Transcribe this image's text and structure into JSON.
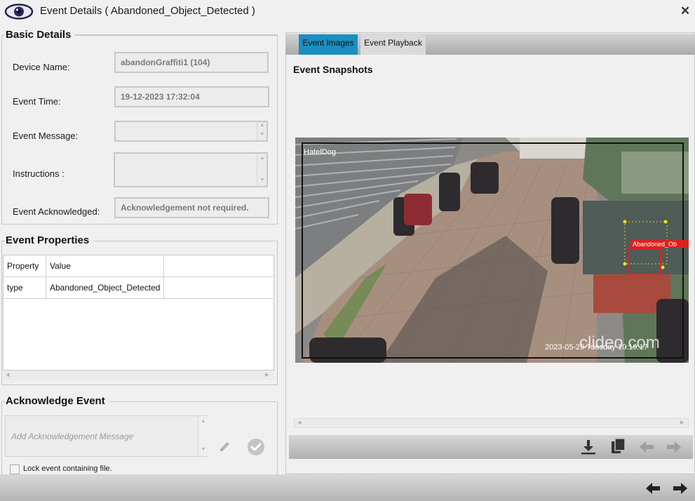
{
  "window": {
    "title": "Event Details ( Abandoned_Object_Detected )",
    "close_icon": "close-icon"
  },
  "basic_details": {
    "heading": "Basic Details",
    "device_name_label": "Device Name:",
    "device_name_value": "abandonGraffiti1 (104)",
    "event_time_label": "Event Time:",
    "event_time_value": "19-12-2023 17:32:04",
    "event_message_label": "Event Message:",
    "event_message_value": "",
    "instructions_label": "Instructions :",
    "instructions_value": "",
    "event_ack_label": "Event Acknowledged:",
    "event_ack_value": "Acknowledgement not required."
  },
  "event_properties": {
    "heading": "Event Properties",
    "columns": [
      "Property",
      "Value"
    ],
    "rows": [
      {
        "property": "type",
        "value": "Abandoned_Object_Detected"
      }
    ]
  },
  "acknowledge_event": {
    "heading": "Acknowledge Event",
    "placeholder": "Add Acknowledgement Message",
    "lock_label": "Lock event containing file."
  },
  "tabs": {
    "images": "Event Images",
    "playback": "Event Playback"
  },
  "snapshots": {
    "heading": "Event Snapshots",
    "overlay_camera": "HatelDog",
    "overlay_timestamp": "2023-05-29 Tuesday 10:19:17",
    "detection_label": "Abandoned_Ob",
    "watermark": "clideo.com"
  },
  "colors": {
    "accent_tab": "#1b8ec0",
    "detection": "#e02020"
  }
}
